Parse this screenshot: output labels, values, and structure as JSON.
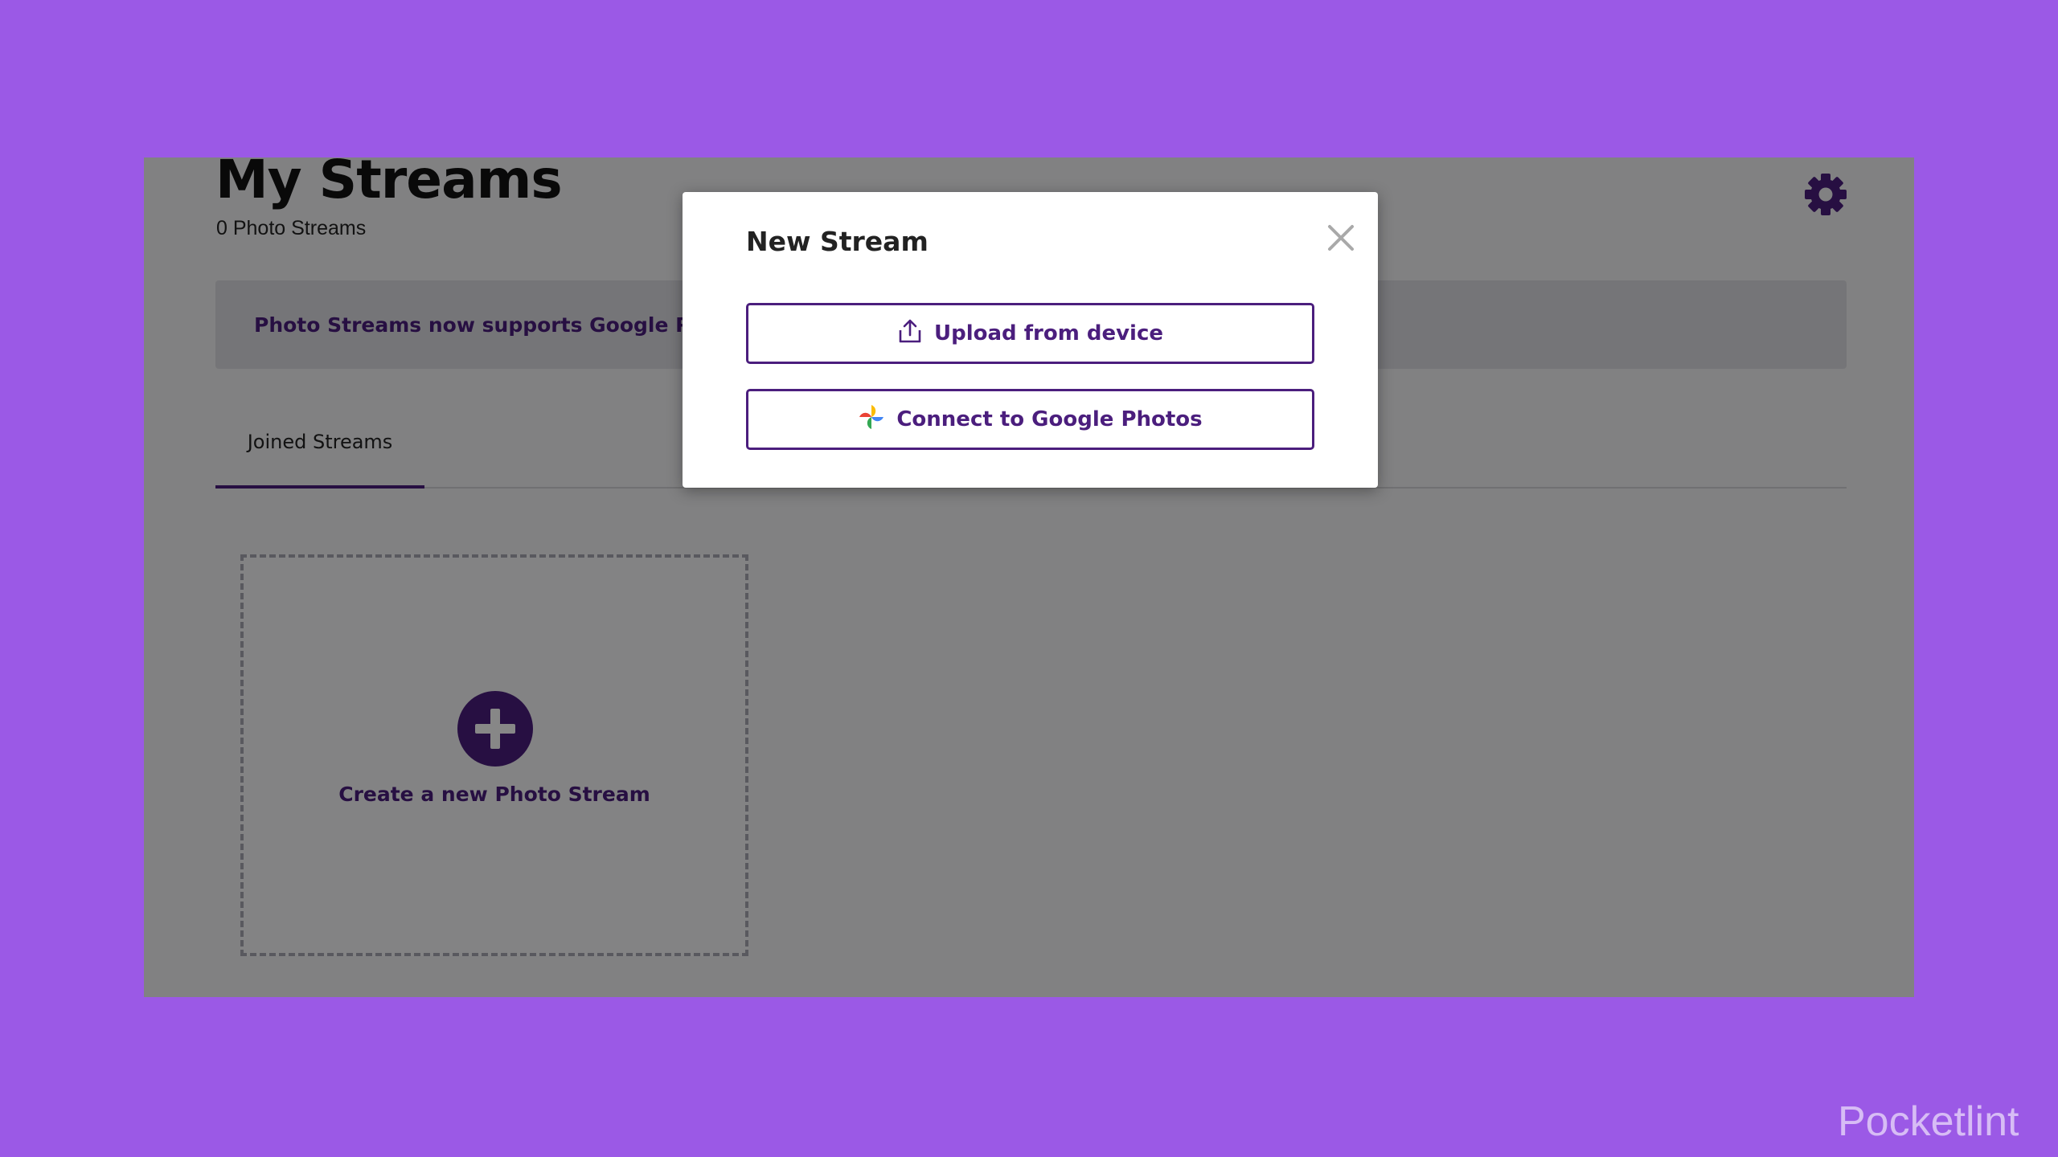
{
  "page": {
    "title": "My Streams",
    "count": "0 Photo Streams",
    "settings_icon": "gear-icon"
  },
  "banner": {
    "text": "Photo Streams now supports Google Photos"
  },
  "tabs": [
    {
      "label": "Joined Streams",
      "active": true
    }
  ],
  "create_card": {
    "label": "Create a new Photo Stream",
    "icon": "plus-icon"
  },
  "modal": {
    "title": "New Stream",
    "close_icon": "close-icon",
    "upload": {
      "label": "Upload from device",
      "icon": "upload-icon"
    },
    "google": {
      "label": "Connect to Google Photos",
      "icon": "google-photos-icon"
    }
  },
  "watermark": {
    "text": "Pocketlint"
  },
  "colors": {
    "background": "#9b59e6",
    "accent": "#4b1e7d",
    "overlay": "rgba(0,0,0,0.47)"
  }
}
